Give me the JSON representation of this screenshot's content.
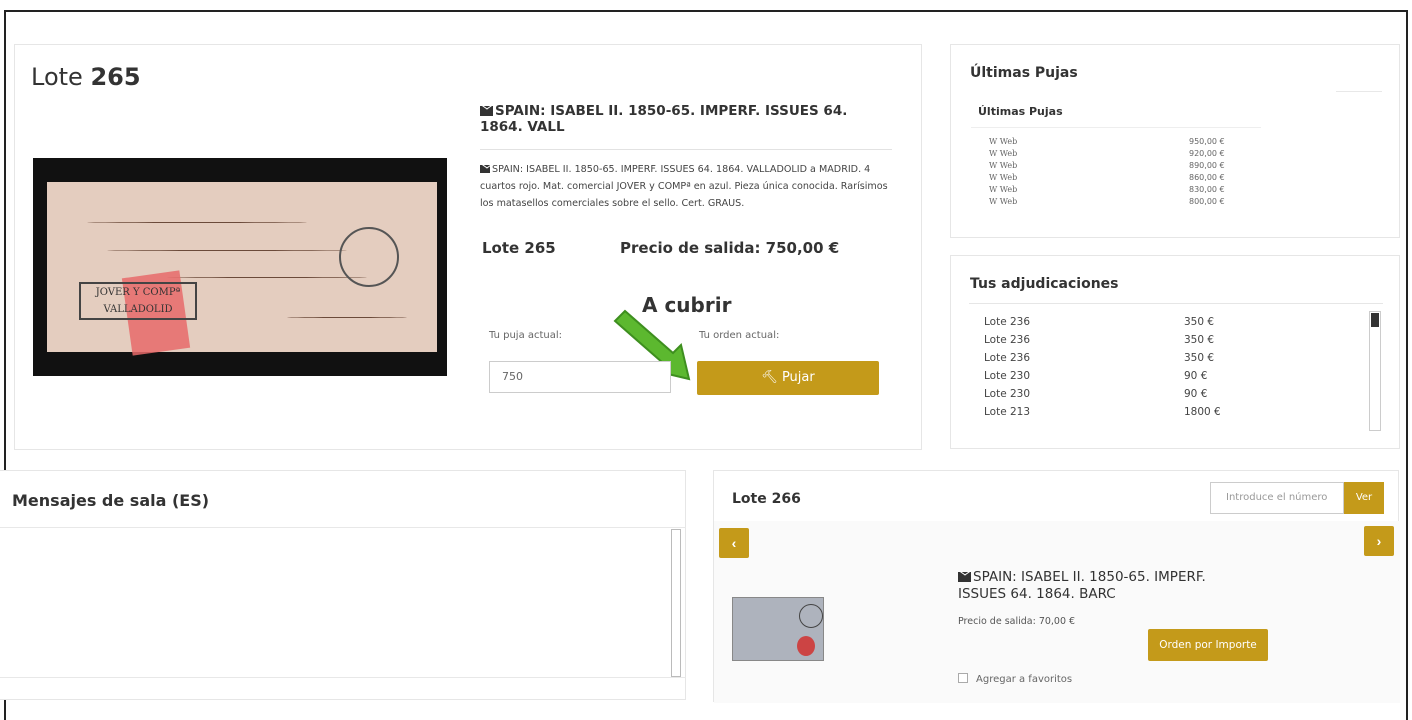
{
  "lot": {
    "title_prefix": "Lote",
    "title_number": "265",
    "desc_title": "SPAIN: ISABEL II. 1850-65. IMPERF. ISSUES 64. 1864. VALL",
    "description": "SPAIN: ISABEL II. 1850-65. IMPERF. ISSUES 64. 1864. VALLADOLID a MADRID. 4 cuartos rojo. Mat. comercial JOVER y COMPª en azul. Pieza única conocida. Rarísimos los matasellos comerciales sobre el sello. Cert. GRAUS.",
    "number_label": "Lote  265",
    "price_label": "Precio de salida: 750,00 €",
    "annotation": "A cubrir",
    "current_bid_label": "Tu puja actual:",
    "current_order_label": "Tu orden actual:",
    "bid_value": "750",
    "bid_button": "Pujar",
    "envelope_text": [
      "JOVER Y COMPª",
      "VALLADOLID"
    ]
  },
  "latest_bids": {
    "title": "Últimas Pujas",
    "subtitle": "Últimas Pujas",
    "rows": [
      {
        "source": "W Web",
        "amount": "950,00 €"
      },
      {
        "source": "W Web",
        "amount": "920,00 €"
      },
      {
        "source": "W Web",
        "amount": "890,00 €"
      },
      {
        "source": "W Web",
        "amount": "860,00 €"
      },
      {
        "source": "W Web",
        "amount": "830,00 €"
      },
      {
        "source": "W Web",
        "amount": "800,00 €"
      }
    ]
  },
  "adjudications": {
    "title": "Tus adjudicaciones",
    "rows": [
      {
        "lot": "Lote 236",
        "amount": "350 €"
      },
      {
        "lot": "Lote 236",
        "amount": "350 €"
      },
      {
        "lot": "Lote 236",
        "amount": "350 €"
      },
      {
        "lot": "Lote 230",
        "amount": "90 €"
      },
      {
        "lot": "Lote 230",
        "amount": "90 €"
      },
      {
        "lot": "Lote 213",
        "amount": "1800 €"
      }
    ]
  },
  "messages": {
    "title": "Mensajes de sala (ES)"
  },
  "next_lot": {
    "title": "Lote 266",
    "number_placeholder": "Introduce el número",
    "view_button": "Ver",
    "prev_icon": "‹",
    "next_icon": "›",
    "desc_title": "SPAIN: ISABEL II. 1850-65. IMPERF. ISSUES 64. 1864. BARC",
    "price": "Precio de salida: 70,00 €",
    "order_button": "Orden por Importe",
    "favorites": "Agregar a favoritos"
  },
  "colors": {
    "accent": "#c49a1a",
    "arrow": "#5cb82f"
  }
}
